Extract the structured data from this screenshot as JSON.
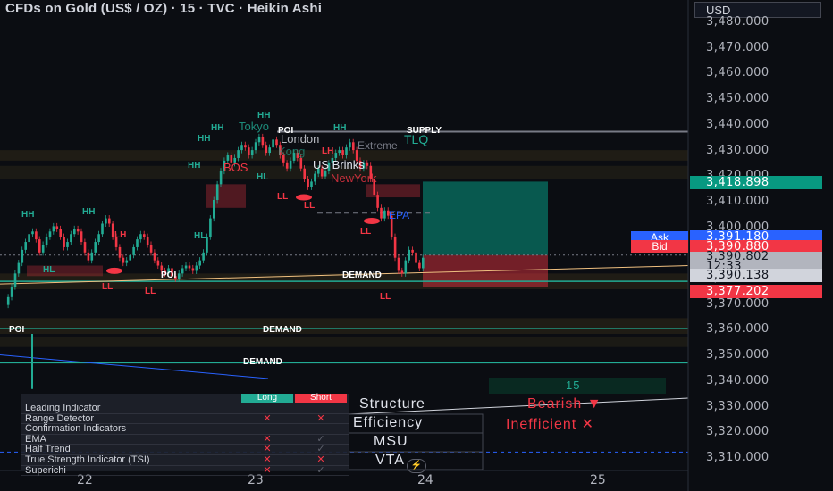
{
  "header": {
    "title": "CFDs on Gold (US$ / OZ) · 15 · TVC · Heikin Ashi",
    "currency": "USD"
  },
  "price_axis": [
    "3,480.000",
    "3,470.000",
    "3,460.000",
    "3,450.000",
    "3,440.000",
    "3,430.000",
    "3,420.000",
    "3,410.000",
    "3,400.000",
    "3,390.000",
    "3,380.000",
    "3,370.000",
    "3,360.000",
    "3,350.000",
    "3,340.000",
    "3,330.000",
    "3,320.000",
    "3,310.000"
  ],
  "price_tags": {
    "last": "3,418.898",
    "ask_label": "Ask",
    "ask": "3,391.180",
    "bid_label": "Bid",
    "bid": "3,390.880",
    "current": "3,390.802",
    "countdown": "12:33",
    "level_a": "3,390.138",
    "level_b": "3,377.202"
  },
  "date_axis": [
    "22",
    "23",
    "24",
    "25"
  ],
  "chart_labels": {
    "hh": "HH",
    "hl": "HL",
    "lh": "LH",
    "ll": "LL",
    "poi": "POI",
    "supply": "SUPPLY",
    "demand": "DEMAND",
    "bos": "BOS",
    "tokyo": "Tokyo",
    "london": "London",
    "us_brinks": "US Brinks",
    "ny": "NewYork",
    "tlq": "TLQ",
    "extreme": "Extreme",
    "eq": "EQ",
    "epa": "EPA",
    "kong": "Kong"
  },
  "indicator_table": {
    "long": "Long",
    "short": "Short",
    "rows": [
      {
        "label": "Leading Indicator",
        "long": "",
        "short": ""
      },
      {
        "label": "Range Detector",
        "long": "✕",
        "short": "✕"
      },
      {
        "label": "Confirmation Indicators",
        "long": "",
        "short": ""
      },
      {
        "label": "EMA",
        "long": "✕",
        "short": "✓"
      },
      {
        "label": "Half Trend",
        "long": "✕",
        "short": "✓"
      },
      {
        "label": "True Strength Indicator (TSI)",
        "long": "✕",
        "short": "✕"
      },
      {
        "label": "Superichi",
        "long": "✕",
        "short": "✓"
      }
    ]
  },
  "info_panel": {
    "timeframe": "15",
    "structure_label": "Structure",
    "structure_value": "Bearish ▼",
    "efficiency_label": "Efficiency",
    "efficiency_value": "Inefficient ✕",
    "msu_label": "MSU",
    "vta_label": "VTA"
  },
  "colors": {
    "bull": "#22ab94",
    "bear": "#f23645",
    "ask": "#2962ff",
    "bid": "#f23645",
    "last": "#089981"
  }
}
